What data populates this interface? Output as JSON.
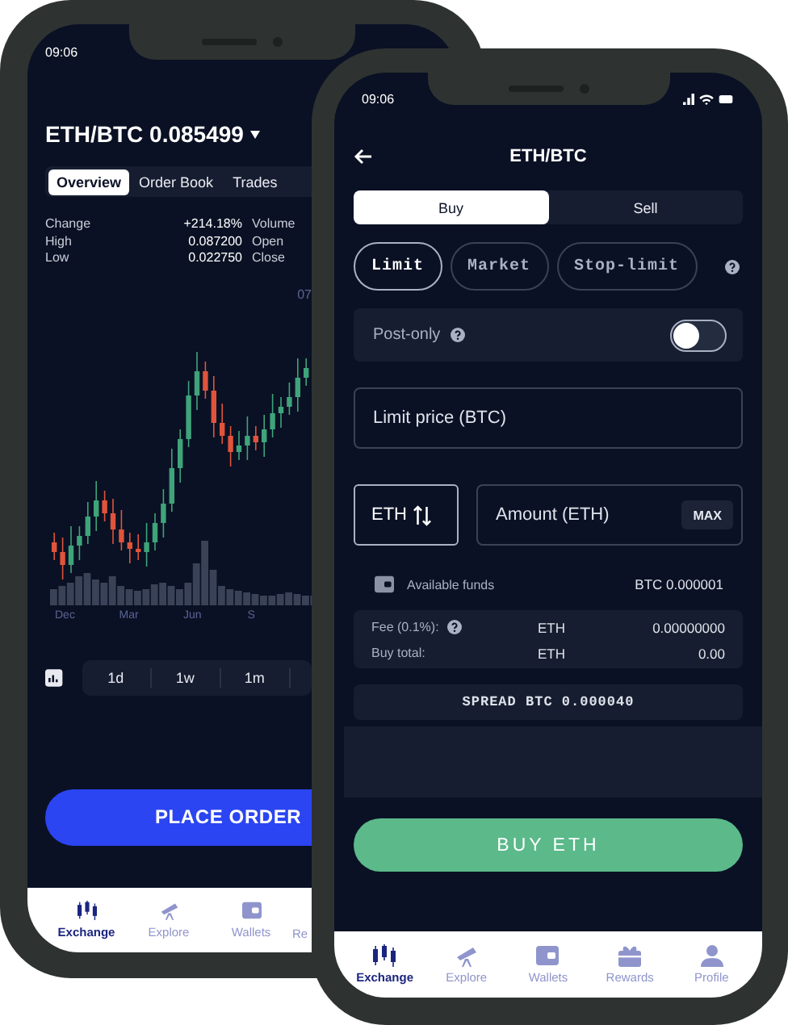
{
  "back_phone": {
    "status_time": "09:06",
    "pair_title": "ETH/BTC 0.085499",
    "tabs": [
      {
        "label": "Overview",
        "selected": true
      },
      {
        "label": "Order Book",
        "selected": false
      },
      {
        "label": "Trades",
        "selected": false
      }
    ],
    "stats": [
      {
        "label": "Change",
        "value": "+214.18%",
        "label_2": "Volume"
      },
      {
        "label": "High",
        "value": "0.087200",
        "label_2": "Open"
      },
      {
        "label": "Low",
        "value": "0.022750",
        "label_2": "Close"
      }
    ],
    "chart_corner_label": "07",
    "chart_months": [
      "Dec",
      "Mar",
      "Jun",
      "S"
    ],
    "timeframes": [
      "1d",
      "1w",
      "1m"
    ],
    "primary_button": "PLACE ORDER",
    "nav": [
      {
        "label": "Exchange",
        "selected": true
      },
      {
        "label": "Explore",
        "selected": false
      },
      {
        "label": "Wallets",
        "selected": false
      },
      {
        "label": "Re",
        "selected": false
      }
    ]
  },
  "front_phone": {
    "status_time": "09:06",
    "title": "ETH/BTC",
    "sides": [
      {
        "label": "Buy",
        "selected": true
      },
      {
        "label": "Sell",
        "selected": false
      }
    ],
    "order_types": [
      {
        "label": "Limit",
        "selected": true
      },
      {
        "label": "Market",
        "selected": false
      },
      {
        "label": "Stop-limit",
        "selected": false
      }
    ],
    "post_only": {
      "label": "Post-only",
      "on": false
    },
    "limit_price": {
      "placeholder": "Limit price (BTC)"
    },
    "currency_toggle": "ETH",
    "amount": {
      "placeholder": "Amount (ETH)",
      "max_label": "MAX"
    },
    "available_funds": {
      "label": "Available funds",
      "value": "BTC 0.000001"
    },
    "fees": [
      {
        "label": "Fee (0.1%):",
        "help": true,
        "currency": "ETH",
        "value": "0.00000000"
      },
      {
        "label": "Buy total:",
        "help": false,
        "currency": "ETH",
        "value": "0.00"
      }
    ],
    "spread": "SPREAD BTC 0.000040",
    "action_button": "BUY ETH",
    "nav": [
      {
        "label": "Exchange",
        "selected": true
      },
      {
        "label": "Explore",
        "selected": false
      },
      {
        "label": "Wallets",
        "selected": false
      },
      {
        "label": "Rewards",
        "selected": false
      },
      {
        "label": "Profile",
        "selected": false
      }
    ]
  }
}
